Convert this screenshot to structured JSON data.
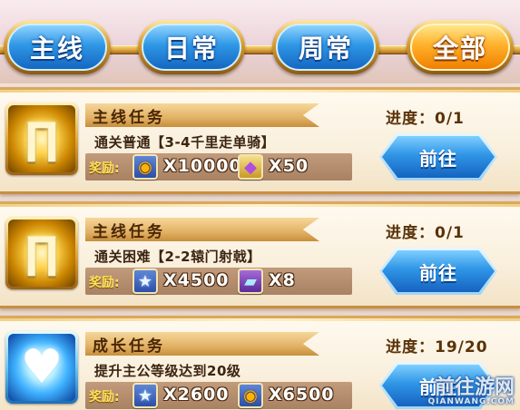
{
  "tabs": [
    {
      "label": "主线",
      "active": false
    },
    {
      "label": "日常",
      "active": false
    },
    {
      "label": "周常",
      "active": false
    },
    {
      "label": "全部",
      "active": true
    }
  ],
  "progress_label": "进度：",
  "reward_label": "奖励:",
  "go_label": "前往",
  "quests": [
    {
      "category": "主线任务",
      "description": "通关普通【3-4千里走单骑】",
      "progress": "0/1",
      "icon": "golden-pillar-icon",
      "rewards": [
        {
          "icon": "coin-icon",
          "amount": "X10000"
        },
        {
          "icon": "gem-icon",
          "amount": "X50"
        }
      ]
    },
    {
      "category": "主线任务",
      "description": "通关困难【2-2辕门射戟】",
      "progress": "0/1",
      "icon": "golden-pillar-icon",
      "rewards": [
        {
          "icon": "star-icon",
          "amount": "X4500"
        },
        {
          "icon": "iron-ore-icon",
          "amount": "X8"
        }
      ]
    },
    {
      "category": "成长任务",
      "description": "提升主公等级达到20级",
      "progress": "19/20",
      "icon": "blue-heart-icon",
      "rewards": [
        {
          "icon": "star-icon",
          "amount": "X2600"
        },
        {
          "icon": "coin-icon",
          "amount": "X6500"
        }
      ]
    }
  ],
  "watermark": {
    "text": "前往游网",
    "url": "QIANWANG.COM"
  }
}
